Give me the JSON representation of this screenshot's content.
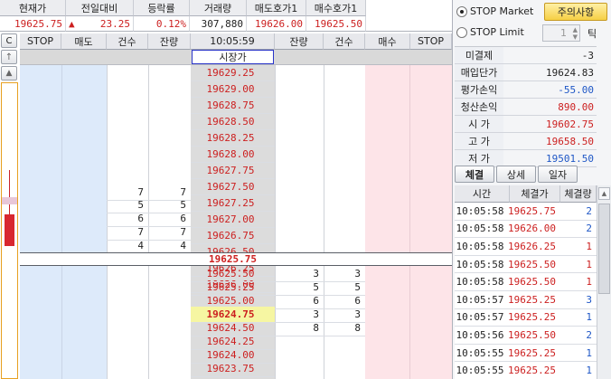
{
  "quote": {
    "headers": [
      "현재가",
      "전일대비",
      "등락률",
      "거래량",
      "매도호가1",
      "매수호가1"
    ],
    "current_price": "19625.75",
    "change_arrow": "▲",
    "change": "23.25",
    "change_rate": "0.12%",
    "volume": "307,880",
    "ask1": "19626.00",
    "bid1": "19625.50"
  },
  "order_mode": {
    "stop_market_label": "STOP Market",
    "stop_limit_label": "STOP Limit",
    "notice_button": "주의사항",
    "tick_value": "1",
    "tick_unit": "틱"
  },
  "grid": {
    "side_buttons": [
      "C",
      "↑",
      "▲"
    ],
    "headers": [
      "STOP",
      "매도",
      "건수",
      "잔량",
      "10:05:59",
      "잔량",
      "건수",
      "매수",
      "STOP"
    ],
    "market_price_label": "시장가",
    "sell_rows": [
      {
        "price": "19629.25",
        "count": "",
        "qty": ""
      },
      {
        "price": "19629.00",
        "count": "",
        "qty": ""
      },
      {
        "price": "19628.75",
        "count": "",
        "qty": ""
      },
      {
        "price": "19628.50",
        "count": "",
        "qty": ""
      },
      {
        "price": "19628.25",
        "count": "",
        "qty": ""
      },
      {
        "price": "19628.00",
        "count": "",
        "qty": ""
      },
      {
        "price": "19627.75",
        "count": "",
        "qty": ""
      },
      {
        "price": "19627.50",
        "count": "",
        "qty": ""
      },
      {
        "price": "19627.25",
        "count": "",
        "qty": ""
      },
      {
        "price": "19627.00",
        "count": "7",
        "qty": "7"
      },
      {
        "price": "19626.75",
        "count": "5",
        "qty": "5"
      },
      {
        "price": "19626.50",
        "count": "6",
        "qty": "6"
      },
      {
        "price": "19626.25",
        "count": "7",
        "qty": "7"
      },
      {
        "price": "19626.00",
        "count": "4",
        "qty": "4"
      }
    ],
    "current_row_price": "19625.75",
    "buy_rows": [
      {
        "price": "19625.50",
        "qty": "3",
        "count": "3"
      },
      {
        "price": "19625.25",
        "qty": "5",
        "count": "5"
      },
      {
        "price": "19625.00",
        "qty": "6",
        "count": "6"
      },
      {
        "price": "19624.75",
        "qty": "3",
        "count": "3"
      },
      {
        "price": "19624.50",
        "qty": "8",
        "count": "8"
      },
      {
        "price": "19624.25",
        "qty": "",
        "count": ""
      },
      {
        "price": "19624.00",
        "qty": "",
        "count": ""
      },
      {
        "price": "19623.75",
        "qty": "",
        "count": ""
      }
    ]
  },
  "account": {
    "unsettled_label": "미결제",
    "unsettled_value": "-3",
    "avg_price_label": "매입단가",
    "avg_price_value": "19624.83",
    "eval_pl_label": "평가손익",
    "eval_pl_value": "-55.00",
    "realized_pl_label": "청산손익",
    "realized_pl_value": "890.00",
    "open_label": "시 가",
    "open_value": "19602.75",
    "high_label": "고 가",
    "high_value": "19658.50",
    "low_label": "저 가",
    "low_value": "19501.50"
  },
  "trades": {
    "tabs": [
      "체결",
      "상세",
      "일자"
    ],
    "headers": [
      "시간",
      "체결가",
      "체결량"
    ],
    "rows": [
      {
        "time": "10:05:58",
        "price": "19625.75",
        "qty": "2",
        "price_color": "red",
        "qty_color": "blue"
      },
      {
        "time": "10:05:58",
        "price": "19626.00",
        "qty": "2",
        "price_color": "red",
        "qty_color": "blue"
      },
      {
        "time": "10:05:58",
        "price": "19626.25",
        "qty": "1",
        "price_color": "red",
        "qty_color": "red"
      },
      {
        "time": "10:05:58",
        "price": "19625.50",
        "qty": "1",
        "price_color": "red",
        "qty_color": "red"
      },
      {
        "time": "10:05:58",
        "price": "19625.50",
        "qty": "1",
        "price_color": "red",
        "qty_color": "red"
      },
      {
        "time": "10:05:57",
        "price": "19625.25",
        "qty": "3",
        "price_color": "red",
        "qty_color": "blue"
      },
      {
        "time": "10:05:57",
        "price": "19625.25",
        "qty": "1",
        "price_color": "red",
        "qty_color": "blue"
      },
      {
        "time": "10:05:56",
        "price": "19625.50",
        "qty": "2",
        "price_color": "red",
        "qty_color": "blue"
      },
      {
        "time": "10:05:55",
        "price": "19625.25",
        "qty": "1",
        "price_color": "red",
        "qty_color": "blue"
      },
      {
        "time": "10:05:55",
        "price": "19625.25",
        "qty": "1",
        "price_color": "red",
        "qty_color": "blue"
      }
    ]
  },
  "colors": {
    "price_red": "#cc1f1f",
    "price_blue": "#1f57c6",
    "sell_bg": "#ddeafa",
    "buy_bg": "#fde4e8",
    "price_col_bg": "#dcdcdc",
    "highlight_yellow": "#f6f6a2"
  }
}
